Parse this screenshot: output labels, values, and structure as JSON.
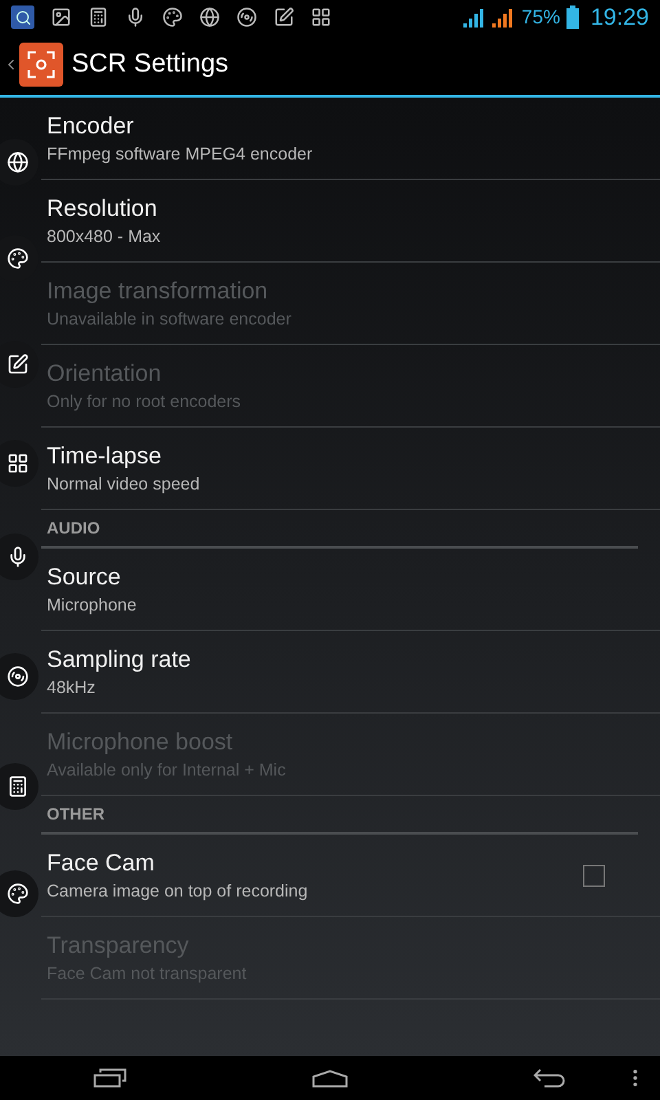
{
  "status_bar": {
    "battery": "75%",
    "time": "19:29"
  },
  "action_bar": {
    "title": "SCR Settings"
  },
  "items": [
    {
      "kind": "pref",
      "title": "Encoder",
      "summary": "FFmpeg software MPEG4 encoder",
      "disabled": false
    },
    {
      "kind": "pref",
      "title": "Resolution",
      "summary": "800x480 - Max",
      "disabled": false
    },
    {
      "kind": "pref",
      "title": "Image transformation",
      "summary": "Unavailable in software encoder",
      "disabled": true
    },
    {
      "kind": "pref",
      "title": "Orientation",
      "summary": "Only for no root encoders",
      "disabled": true
    },
    {
      "kind": "pref",
      "title": "Time-lapse",
      "summary": "Normal video speed",
      "disabled": false
    },
    {
      "kind": "header",
      "title": "AUDIO"
    },
    {
      "kind": "pref",
      "title": "Source",
      "summary": "Microphone",
      "disabled": false
    },
    {
      "kind": "pref",
      "title": "Sampling rate",
      "summary": "48kHz",
      "disabled": false
    },
    {
      "kind": "pref",
      "title": "Microphone boost",
      "summary": "Available only for Internal + Mic",
      "disabled": true
    },
    {
      "kind": "header",
      "title": "OTHER"
    },
    {
      "kind": "check",
      "title": "Face Cam",
      "summary": "Camera image on top of recording",
      "disabled": false,
      "checked": false
    },
    {
      "kind": "pref",
      "title": "Transparency",
      "summary": "Face Cam not transparent",
      "disabled": true
    }
  ]
}
